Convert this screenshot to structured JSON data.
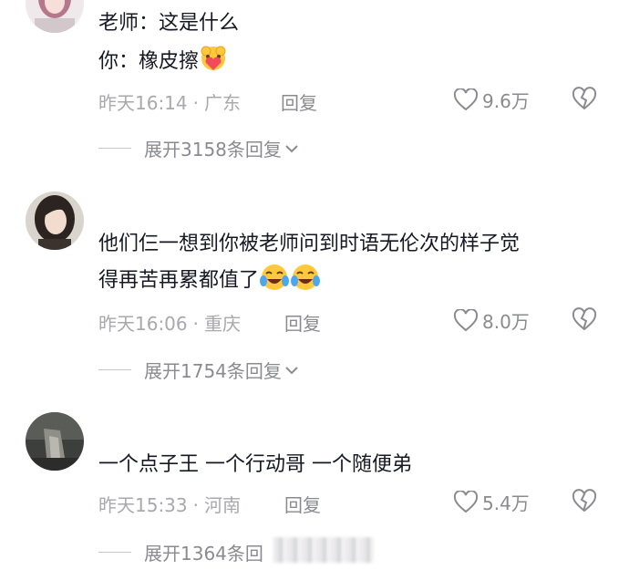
{
  "comments": [
    {
      "lines": [
        "老师：这是什么",
        "你：橡皮擦"
      ],
      "time": "昨天16:14",
      "location": "广东",
      "reply_label": "回复",
      "likes": "9.6万",
      "expand_label": "展开3158条回复"
    },
    {
      "lines": [
        "他们仨一想到你被老师问到时语无伦次的样子觉",
        "得再苦再累都值了"
      ],
      "time": "昨天16:06",
      "location": "重庆",
      "reply_label": "回复",
      "likes": "8.0万",
      "expand_label": "展开1754条回复"
    },
    {
      "lines": [
        "一个点子王 一个行动哥 一个随便弟"
      ],
      "time": "昨天15:33",
      "location": "河南",
      "reply_label": "回复",
      "likes": "5.4万",
      "expand_label": "展开1364条回"
    }
  ],
  "separator": "·",
  "icons": {
    "like": "heart-outline-icon",
    "dislike": "broken-heart-icon",
    "expand": "chevron-down-icon",
    "emoji_heart": "heart-hug-emoji",
    "emoji_laugh": "tears-of-joy-emoji"
  },
  "colors": {
    "text": "#161823",
    "meta": "#a8a9ad",
    "action": "#8a8b91"
  }
}
